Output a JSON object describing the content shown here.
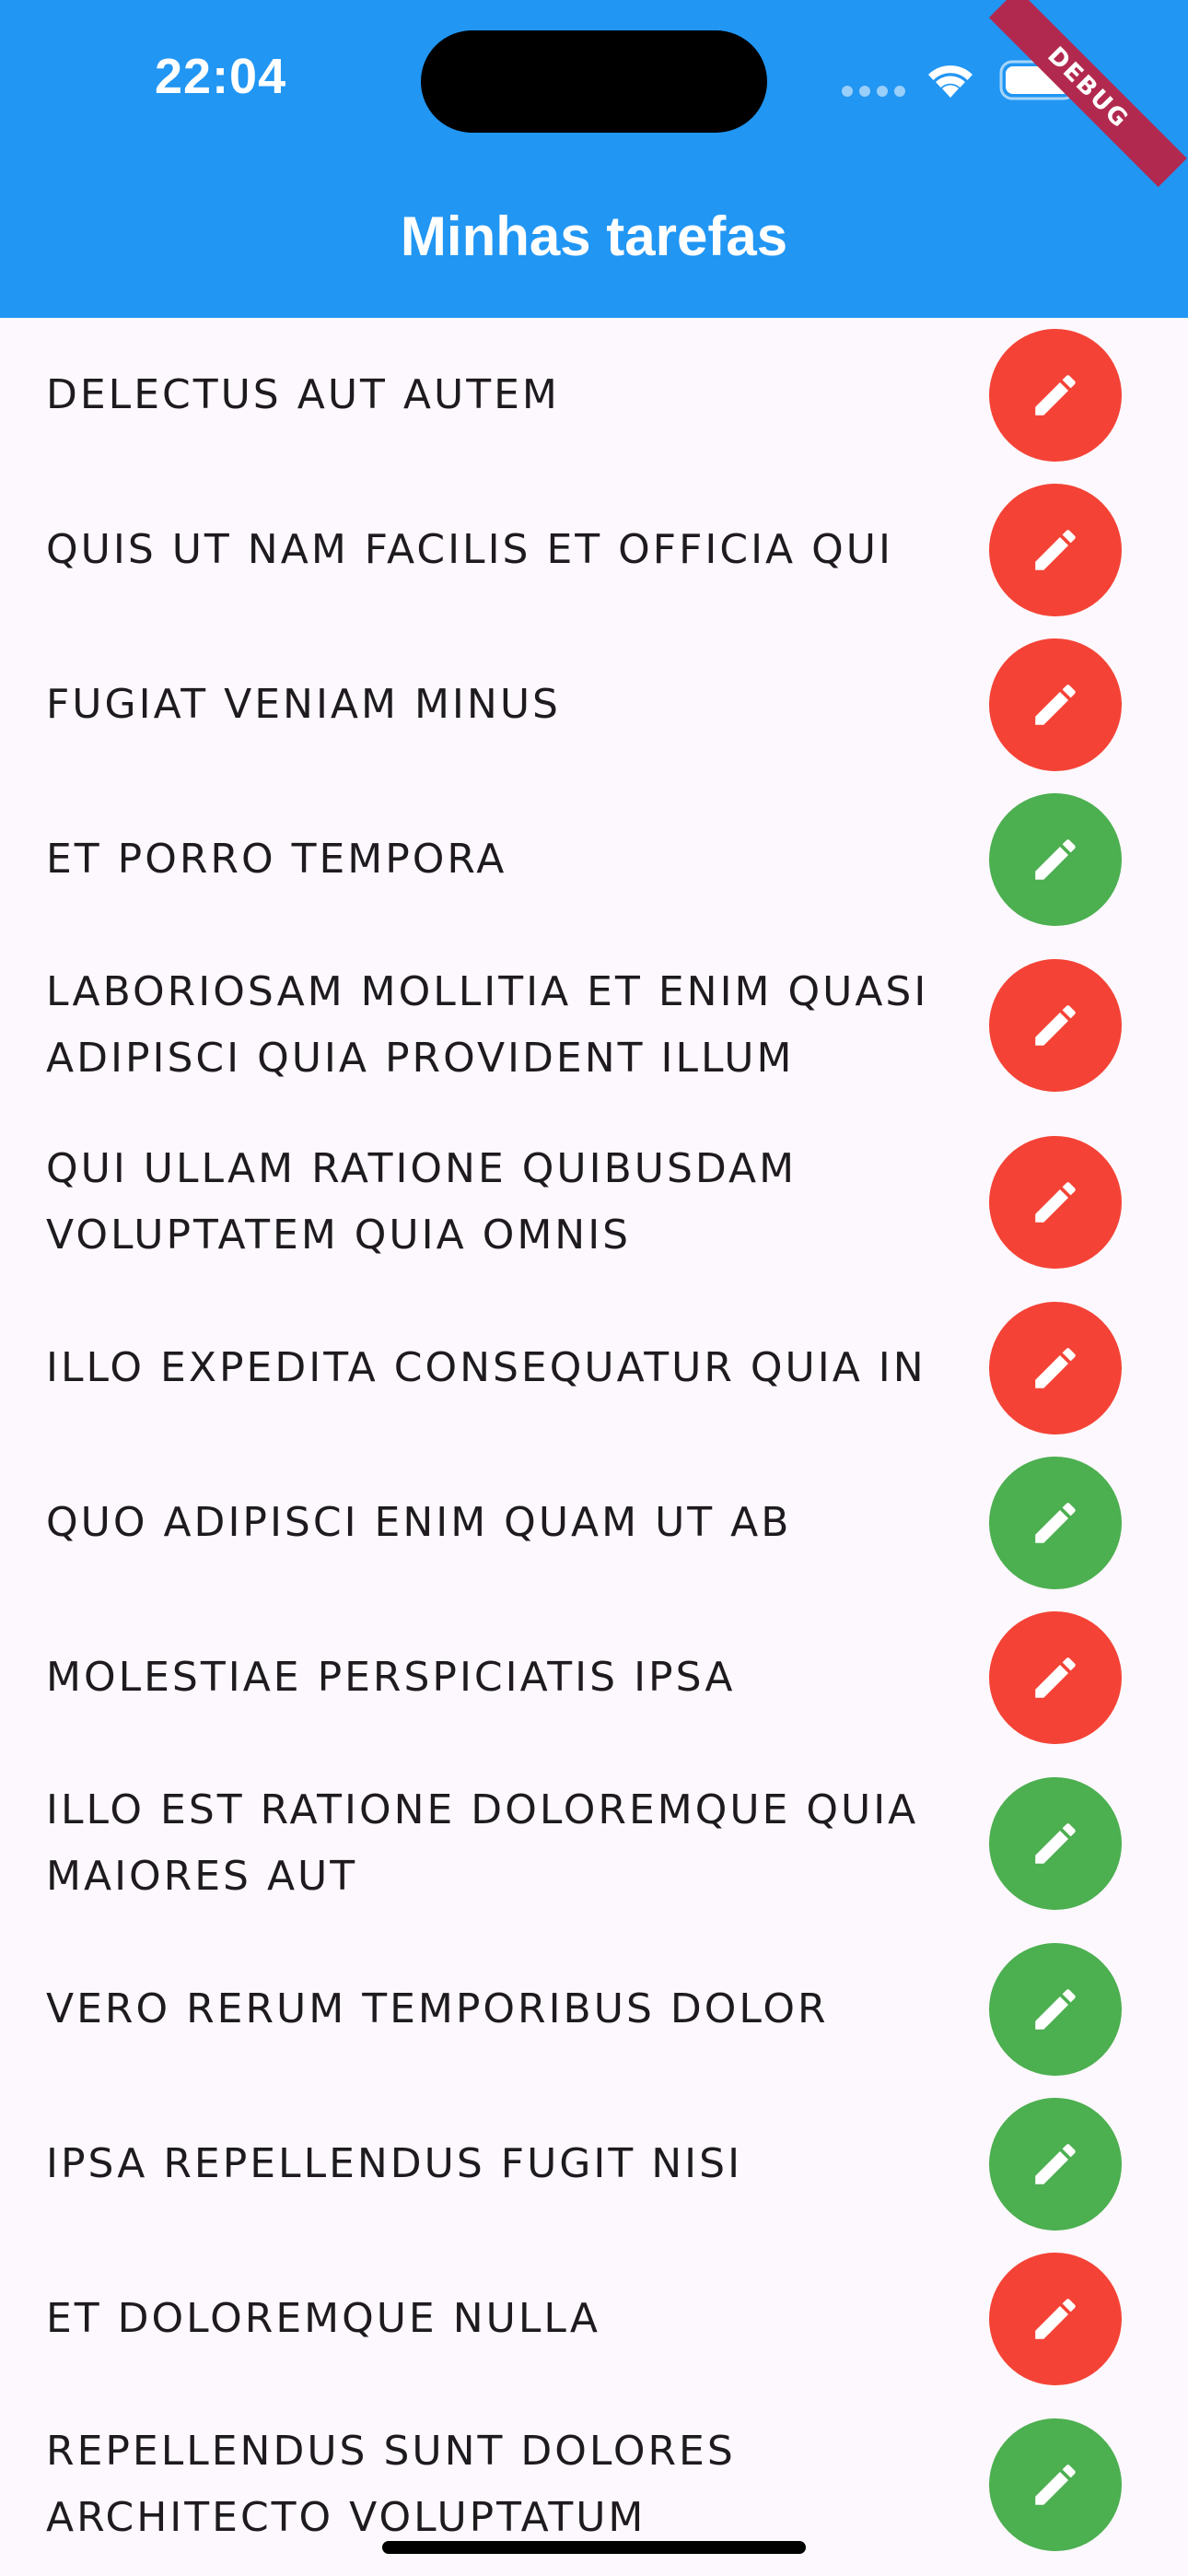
{
  "status_bar": {
    "time": "22:04"
  },
  "debug_banner": "DEBUG",
  "app_bar": {
    "title": "Minhas tarefas"
  },
  "colors": {
    "app_bar": "#2196f3",
    "pending": "#f44336",
    "done": "#4caf50",
    "icon": "#ffffff"
  },
  "icons": {
    "edit": "pencil-icon"
  },
  "tasks": [
    {
      "title": "DELECTUS AUT AUTEM",
      "status": "pending"
    },
    {
      "title": "QUIS UT NAM FACILIS ET OFFICIA QUI",
      "status": "pending"
    },
    {
      "title": "FUGIAT VENIAM MINUS",
      "status": "pending"
    },
    {
      "title": "ET PORRO TEMPORA",
      "status": "done"
    },
    {
      "title": "LABORIOSAM MOLLITIA ET ENIM QUASI ADIPISCI QUIA PROVIDENT ILLUM",
      "status": "pending"
    },
    {
      "title": "QUI ULLAM RATIONE QUIBUSDAM VOLUPTATEM QUIA OMNIS",
      "status": "pending"
    },
    {
      "title": "ILLO EXPEDITA CONSEQUATUR QUIA IN",
      "status": "pending"
    },
    {
      "title": "QUO ADIPISCI ENIM QUAM UT AB",
      "status": "done"
    },
    {
      "title": "MOLESTIAE PERSPICIATIS IPSA",
      "status": "pending"
    },
    {
      "title": "ILLO EST RATIONE DOLOREMQUE QUIA MAIORES AUT",
      "status": "done"
    },
    {
      "title": "VERO RERUM TEMPORIBUS DOLOR",
      "status": "done"
    },
    {
      "title": "IPSA REPELLENDUS FUGIT NISI",
      "status": "done"
    },
    {
      "title": "ET DOLOREMQUE NULLA",
      "status": "pending"
    },
    {
      "title": "REPELLENDUS SUNT DOLORES ARCHITECTO VOLUPTATUM",
      "status": "done"
    }
  ]
}
